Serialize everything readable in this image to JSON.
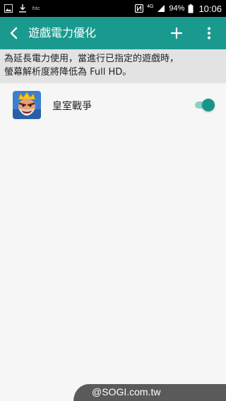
{
  "status_bar": {
    "carrier": "htc",
    "network": "4G",
    "battery": "94%",
    "time": "10:06",
    "icons": [
      "image-icon",
      "download-icon",
      "nfc-icon",
      "lte-icon",
      "signal-icon",
      "battery-icon"
    ]
  },
  "app_bar": {
    "title": "遊戲電力優化",
    "icons": [
      "back-icon",
      "add-icon",
      "more-icon"
    ],
    "color": "#1a9a8f"
  },
  "description": {
    "line1": "為延長電力使用，當進行已指定的遊戲時，",
    "line2": "螢幕解析度將降低為 Full HD。"
  },
  "games": [
    {
      "name": "皇室戰爭",
      "enabled": true
    }
  ],
  "watermark": "@SOGI.com.tw",
  "colors": {
    "accent": "#18958a",
    "description_bg": "#e3e3e3",
    "background": "#f6f6f6"
  }
}
